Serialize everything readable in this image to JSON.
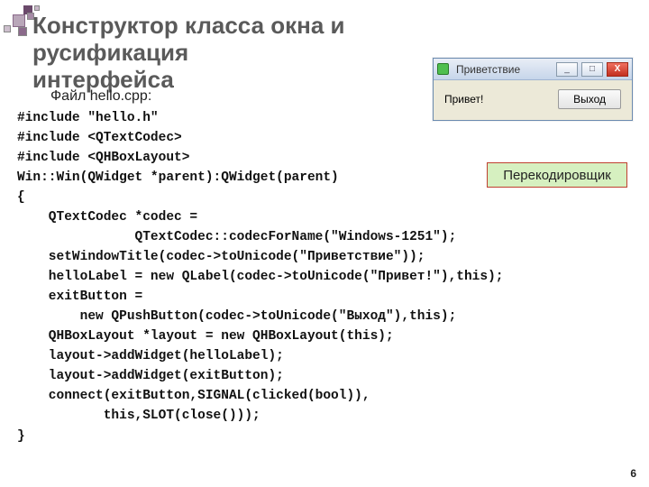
{
  "title_line1": "Конструктор класса окна и русификация",
  "title_line2": "интерфейса",
  "file_caption": "Файл hello.cpp:",
  "code": "#include \"hello.h\"\n#include <QTextCodec>\n#include <QHBoxLayout>\nWin::Win(QWidget *parent):QWidget(parent)\n{\n    QTextCodec *codec =\n               QTextCodec::codecForName(\"Windows-1251\");\n    setWindowTitle(codec->toUnicode(\"Приветствие\"));\n    helloLabel = new QLabel(codec->toUnicode(\"Привет!\"),this);\n    exitButton =\n        new QPushButton(codec->toUnicode(\"Выход\"),this);\n    QHBoxLayout *layout = new QHBoxLayout(this);\n    layout->addWidget(helloLabel);\n    layout->addWidget(exitButton);\n    connect(exitButton,SIGNAL(clicked(bool)),\n           this,SLOT(close()));\n}",
  "mock_window": {
    "title": "Приветствие",
    "label": "Привет!",
    "button": "Выход",
    "min": "_",
    "max": "□",
    "close": "X"
  },
  "callout": "Перекодировщик",
  "page": "6"
}
